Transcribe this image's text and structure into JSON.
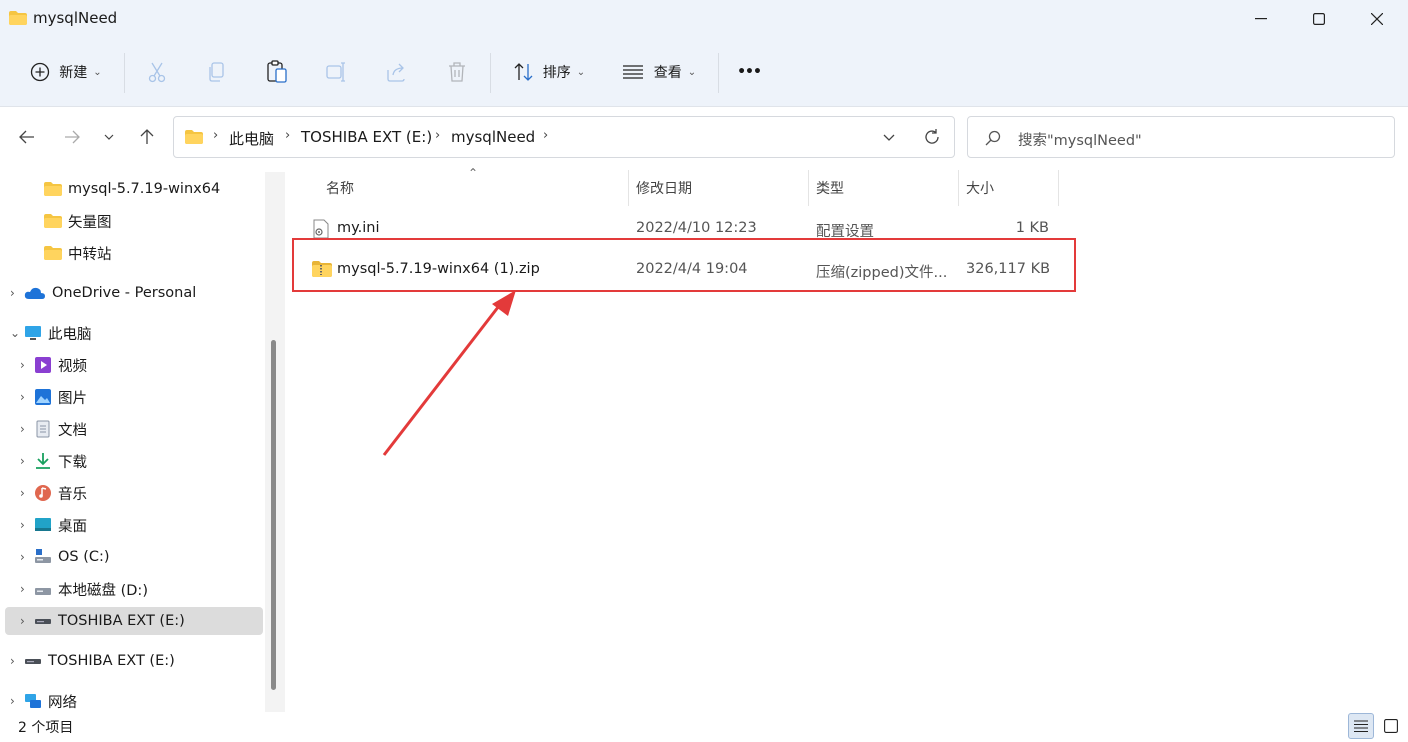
{
  "window": {
    "title": "mysqlNeed"
  },
  "toolbar": {
    "new_label": "新建",
    "sort_label": "排序",
    "view_label": "查看",
    "more_label": "•••"
  },
  "address": {
    "crumbs": [
      "此电脑",
      "TOSHIBA EXT (E:)",
      "mysqlNeed"
    ]
  },
  "search": {
    "placeholder": "搜索\"mysqlNeed\""
  },
  "sidebar": {
    "pinned": [
      {
        "label": "mysql-5.7.19-winx64"
      },
      {
        "label": "矢量图"
      },
      {
        "label": "中转站"
      }
    ],
    "onedrive": "OneDrive - Personal",
    "thispc": "此电脑",
    "thispc_children": [
      {
        "label": "视频"
      },
      {
        "label": "图片"
      },
      {
        "label": "文档"
      },
      {
        "label": "下载"
      },
      {
        "label": "音乐"
      },
      {
        "label": "桌面"
      },
      {
        "label": "OS (C:)"
      },
      {
        "label": "本地磁盘 (D:)"
      },
      {
        "label": "TOSHIBA EXT (E:)"
      }
    ],
    "drive_e": "TOSHIBA EXT (E:)",
    "network": "网络"
  },
  "columns": {
    "name": "名称",
    "modified": "修改日期",
    "type": "类型",
    "size": "大小"
  },
  "files": [
    {
      "name": "my.ini",
      "modified": "2022/4/10 12:23",
      "type": "配置设置",
      "size": "1 KB"
    },
    {
      "name": "mysql-5.7.19-winx64 (1).zip",
      "modified": "2022/4/4 19:04",
      "type": "压缩(zipped)文件...",
      "size": "326,117 KB"
    }
  ],
  "status": {
    "count": "2 个项目"
  },
  "colors": {
    "accent": "#e33a3a",
    "folder": "#f5c542",
    "chrome": "#eef3fa"
  }
}
